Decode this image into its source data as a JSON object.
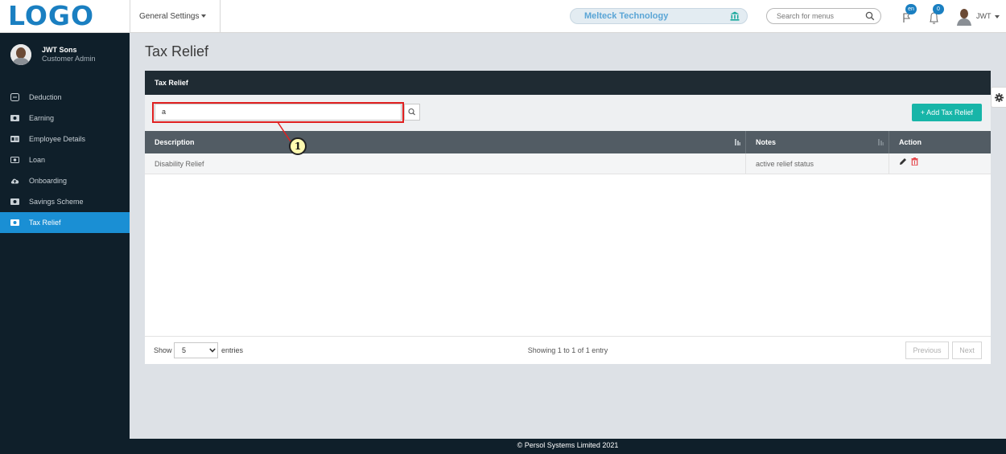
{
  "header": {
    "logo": "LOGO",
    "general_settings": "General Settings",
    "company": "Melteck Technology",
    "search_placeholder": "Search for menus",
    "lang_badge": "en",
    "notif_badge": "0",
    "user": "JWT"
  },
  "sidebar": {
    "profile_name": "JWT Sons",
    "profile_role": "Customer Admin",
    "items": [
      {
        "label": "Deduction",
        "icon": "minus-box-icon"
      },
      {
        "label": "Earning",
        "icon": "money-icon"
      },
      {
        "label": "Employee Details",
        "icon": "id-card-icon"
      },
      {
        "label": "Loan",
        "icon": "cash-icon"
      },
      {
        "label": "Onboarding",
        "icon": "cloud-upload-icon"
      },
      {
        "label": "Savings Scheme",
        "icon": "money-icon"
      },
      {
        "label": "Tax Relief",
        "icon": "money-icon",
        "active": true
      }
    ]
  },
  "main": {
    "page_title": "Tax Relief",
    "panel_title": "Tax Relief",
    "search_value": "a",
    "add_button": "+ Add Tax Relief",
    "columns": [
      "Description",
      "Notes",
      "Action"
    ],
    "rows": [
      {
        "description": "Disability Relief",
        "notes": "active relief status"
      }
    ],
    "show_label": "Show",
    "page_length": "5",
    "entries_label": "entries",
    "info": "Showing 1 to 1 of 1 entry",
    "previous": "Previous",
    "next": "Next"
  },
  "annotation": {
    "callout_number": "1"
  },
  "footer": {
    "copyright": "© Persol Systems Limited 2021"
  },
  "colors": {
    "accent": "#1a8fd4",
    "add_button": "#17b5a8",
    "sidebar": "#0f1f2a",
    "highlight": "#e02020"
  }
}
